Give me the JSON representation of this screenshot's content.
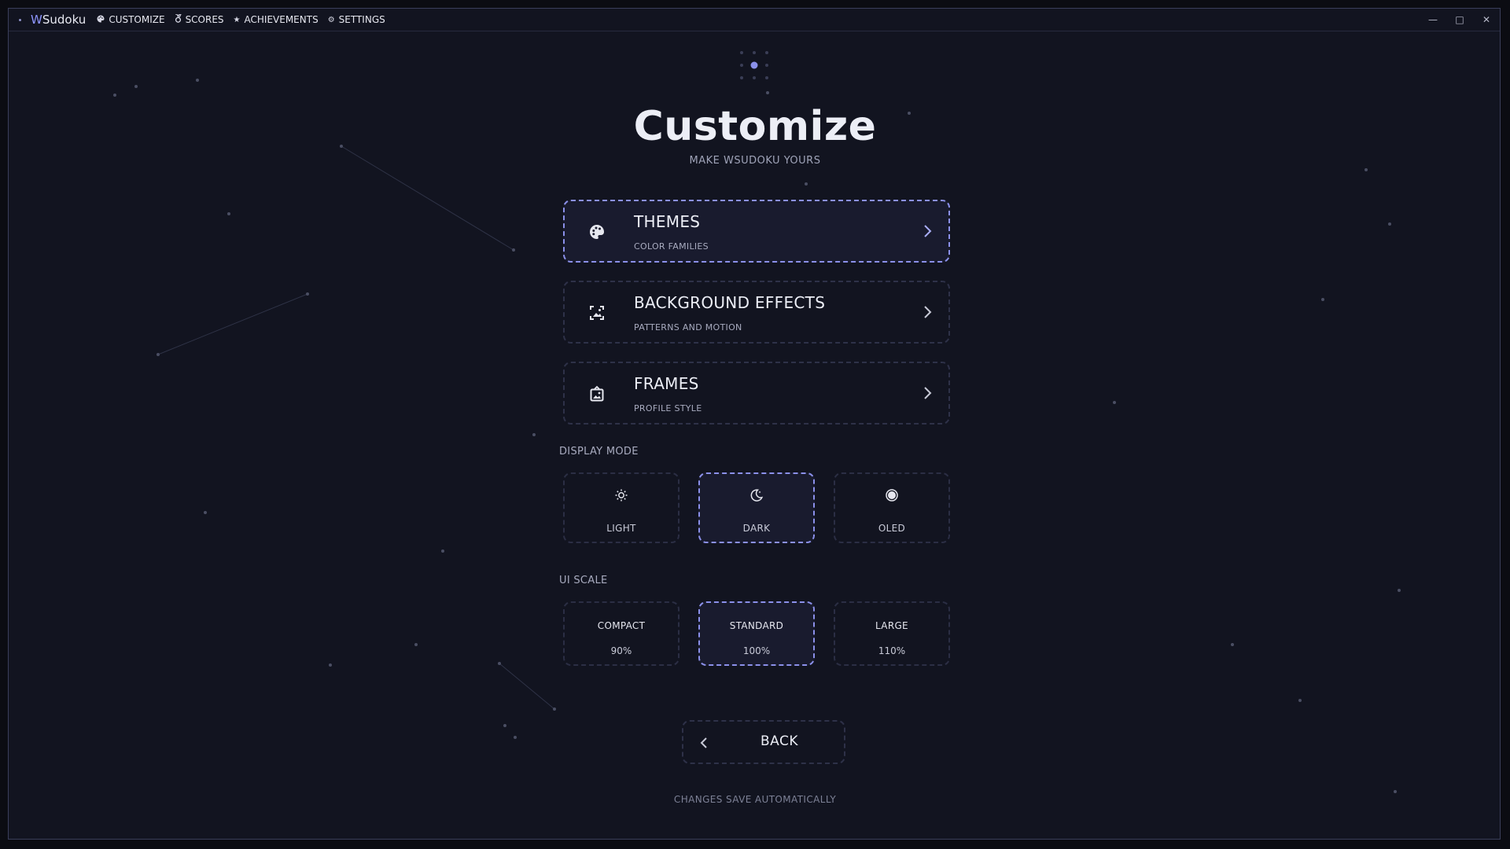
{
  "window": {
    "app_name_accent": "W",
    "app_name_rest": "Sudoku",
    "nav": [
      {
        "label": "CUSTOMIZE",
        "icon": "palette-icon"
      },
      {
        "label": "SCORES",
        "icon": "medal-icon"
      },
      {
        "label": "ACHIEVEMENTS",
        "icon": "star-icon"
      },
      {
        "label": "SETTINGS",
        "icon": "gear-icon"
      }
    ],
    "controls": {
      "minimize": "—",
      "maximize": "□",
      "close": "✕"
    }
  },
  "page": {
    "title": "Customize",
    "subtitle": "MAKE WSUDOKU YOURS"
  },
  "menu": [
    {
      "title": "THEMES",
      "subtitle": "COLOR FAMILIES",
      "icon": "palette-icon",
      "active": true
    },
    {
      "title": "BACKGROUND EFFECTS",
      "subtitle": "PATTERNS AND MOTION",
      "icon": "image-frame-icon",
      "active": false
    },
    {
      "title": "FRAMES",
      "subtitle": "PROFILE STYLE",
      "icon": "portrait-frame-icon",
      "active": false
    }
  ],
  "display_mode": {
    "label": "DISPLAY MODE",
    "options": [
      {
        "label": "LIGHT",
        "icon": "sun-icon"
      },
      {
        "label": "DARK",
        "icon": "moon-icon"
      },
      {
        "label": "OLED",
        "icon": "circle-dot-icon"
      }
    ],
    "selected": "DARK"
  },
  "ui_scale": {
    "label": "UI SCALE",
    "options": [
      {
        "label": "COMPACT",
        "value": "90%"
      },
      {
        "label": "STANDARD",
        "value": "100%"
      },
      {
        "label": "LARGE",
        "value": "110%"
      }
    ],
    "selected": "STANDARD"
  },
  "back_button": {
    "label": "BACK"
  },
  "footer_note": "CHANGES SAVE AUTOMATICALLY",
  "colors": {
    "background": "#121420",
    "accent": "#8b90ea",
    "card_border": "#2e3148",
    "app_accent": "#8f96ff"
  }
}
